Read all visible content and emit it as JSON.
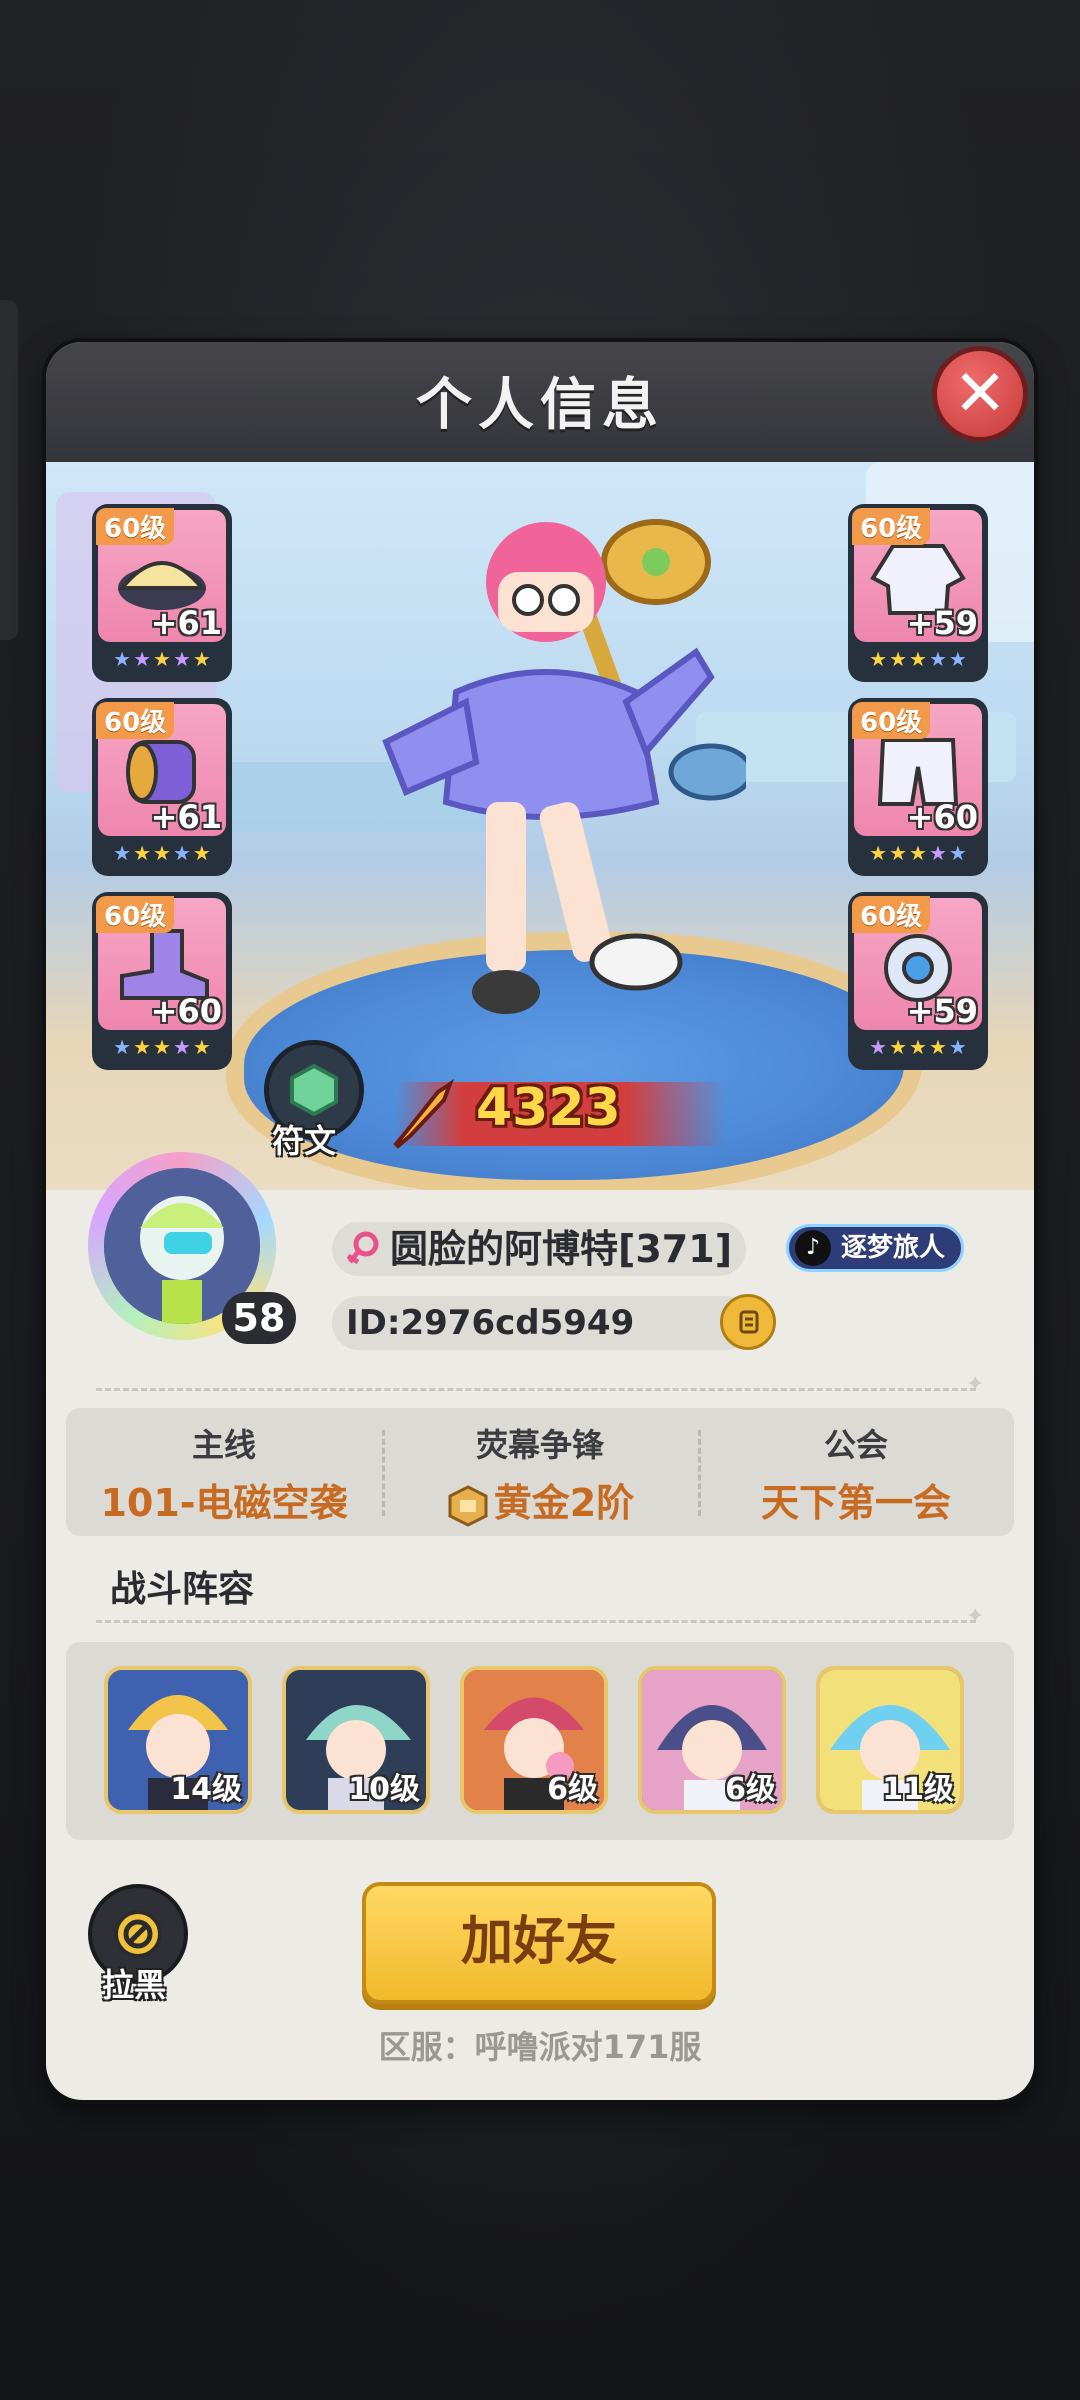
{
  "panel": {
    "title": "个人信息"
  },
  "equipment": {
    "left": [
      {
        "level": "60级",
        "bonus": "+61",
        "icon": "helmet-icon",
        "stars": [
          "#8ab4ff",
          "#c59bff",
          "#ffd23f",
          "#c59bff",
          "#ffd23f"
        ]
      },
      {
        "level": "60级",
        "bonus": "+61",
        "icon": "bracer-icon",
        "stars": [
          "#8ab4ff",
          "#ffd23f",
          "#ffd23f",
          "#8ab4ff",
          "#ffd23f"
        ]
      },
      {
        "level": "60级",
        "bonus": "+60",
        "icon": "boots-icon",
        "stars": [
          "#8ab4ff",
          "#ffd23f",
          "#ffd23f",
          "#c59bff",
          "#ffd23f"
        ]
      }
    ],
    "right": [
      {
        "level": "60级",
        "bonus": "+59",
        "icon": "jacket-icon",
        "stars": [
          "#ffd23f",
          "#ffd23f",
          "#ffd23f",
          "#8ab4ff",
          "#8ab4ff"
        ]
      },
      {
        "level": "60级",
        "bonus": "+60",
        "icon": "pants-icon",
        "stars": [
          "#ffd23f",
          "#ffd23f",
          "#ffd23f",
          "#c59bff",
          "#8ab4ff"
        ]
      },
      {
        "level": "60级",
        "bonus": "+59",
        "icon": "gadget-icon",
        "stars": [
          "#c59bff",
          "#ffd23f",
          "#ffd23f",
          "#ffd23f",
          "#8ab4ff"
        ]
      }
    ]
  },
  "rune_label": "符文",
  "power": "4323",
  "player": {
    "level": "58",
    "name": "圆脸的阿博特[371]",
    "id": "ID:2976cd5949",
    "badge": "逐梦旅人"
  },
  "stats": [
    {
      "label": "主线",
      "value": "101-电磁空袭"
    },
    {
      "label": "荧幕争锋",
      "value": "黄金2阶"
    },
    {
      "label": "公会",
      "value": "天下第一会"
    }
  ],
  "lineup": {
    "title": "战斗阵容",
    "heroes": [
      {
        "level": "14级",
        "color": "#f2c44a"
      },
      {
        "level": "10级",
        "color": "#8fd6c8"
      },
      {
        "level": "6级",
        "color": "#d44a6a"
      },
      {
        "level": "6级",
        "color": "#4a4f8a"
      },
      {
        "level": "11级",
        "color": "#6fd0f0"
      }
    ]
  },
  "actions": {
    "block": "拉黑",
    "add_friend": "加好友"
  },
  "server": "区服：呼噜派对171服",
  "colors": {
    "accent": "#f1b92c",
    "stat_value": "#c86b22",
    "power": "#ffd84a"
  }
}
